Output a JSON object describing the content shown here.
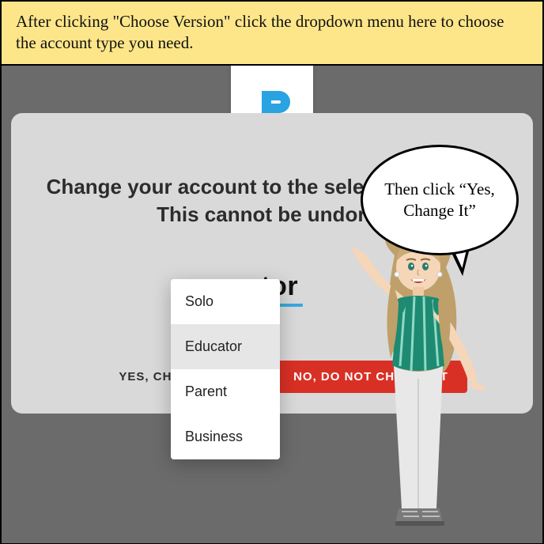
{
  "instruction_banner": "After clicking \"Choose Version\" click the dropdown menu here to choose the account type you need.",
  "speech_bubble": "Then click “Yes, Change It”",
  "logo": {
    "name": "p-logo"
  },
  "modal": {
    "title": "Change your account to the selected version? This cannot be undone.",
    "selected_version_partial": "ator",
    "yes_label": "YES, CHANGE IT",
    "yes_label_visible": "YES, CHANG",
    "no_label": "NO, DO NOT CHANGE IT",
    "no_label_visible": "NO, DO NOT CHANGE IT"
  },
  "dropdown": {
    "items": [
      {
        "label": "Solo",
        "selected": false
      },
      {
        "label": "Educator",
        "selected": true
      },
      {
        "label": "Parent",
        "selected": false
      },
      {
        "label": "Business",
        "selected": false
      }
    ]
  },
  "colors": {
    "banner_bg": "#fde68a",
    "stage_bg": "#6b6b6b",
    "modal_bg": "#d9d9d9",
    "accent": "#3aa8e0",
    "danger": "#d93025"
  }
}
